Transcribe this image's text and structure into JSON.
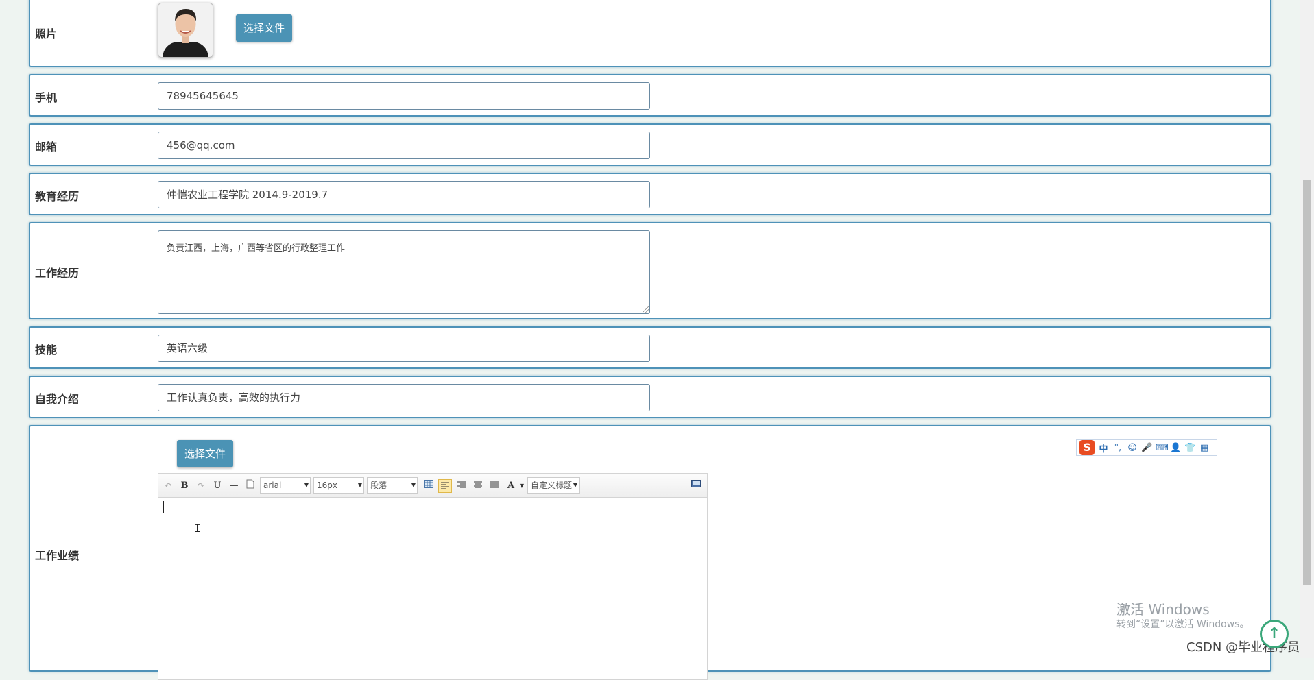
{
  "form": {
    "photo": {
      "label": "照片",
      "button": "选择文件"
    },
    "phone": {
      "label": "手机",
      "value": "78945645645"
    },
    "email": {
      "label": "邮箱",
      "value": "456@qq.com"
    },
    "education": {
      "label": "教育经历",
      "value": "仲恺农业工程学院 2014.9-2019.7"
    },
    "work_experience": {
      "label": "工作经历",
      "value": "负责江西，上海，广西等省区的行政整理工作"
    },
    "skills": {
      "label": "技能",
      "value": "英语六级"
    },
    "self_intro": {
      "label": "自我介绍",
      "value": "工作认真负责，高效的执行力"
    },
    "achievements": {
      "label": "工作业绩",
      "button": "选择文件",
      "editor": {
        "toolbar": {
          "undo": "↶",
          "bold": "B",
          "redo": "↷",
          "underline": "U",
          "hr": "—",
          "font_family": "arial",
          "font_size": "16px",
          "paragraph": "段落",
          "custom_title": "自定义标题",
          "text_color": "A"
        },
        "content": ""
      }
    }
  },
  "ime": {
    "logo": "S",
    "mode": "中",
    "punct": "°,",
    "icons": [
      "☺",
      "🎤",
      "⌨",
      "👤",
      "👕",
      "▦"
    ]
  },
  "watermark": {
    "title": "激活 Windows",
    "subtitle": "转到“设置”以激活 Windows。"
  },
  "csdn": "CSDN @毕业程序员",
  "back_to_top": "↑"
}
